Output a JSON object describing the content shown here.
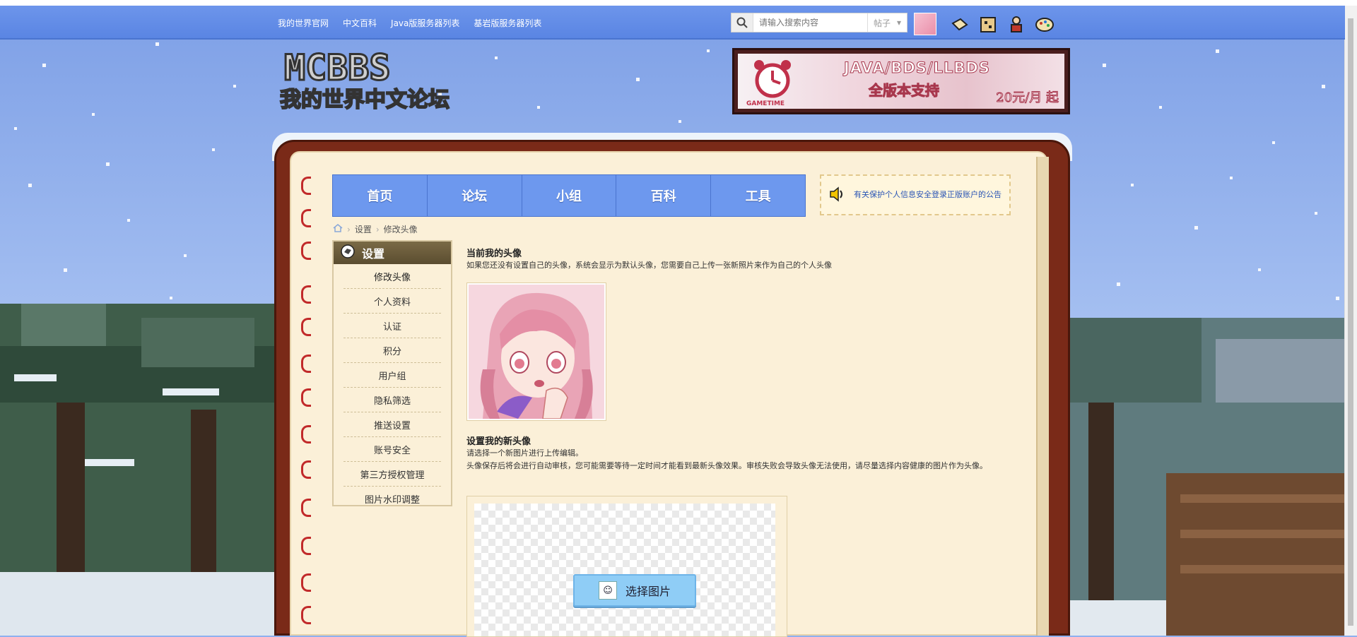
{
  "topbar": {
    "links": [
      "我的世界官网",
      "中文百科",
      "Java版服务器列表",
      "基岩版服务器列表"
    ],
    "search_placeholder": "请输入搜索内容",
    "search_type": "帖子"
  },
  "ad": {
    "title": "JAVA/BDS/LLBDS",
    "subtitle": "全版本支持",
    "price": "20元/月 起",
    "brand": "GAMETIME"
  },
  "main_nav": [
    "首页",
    "论坛",
    "小组",
    "百科",
    "工具"
  ],
  "notice": "有关保护个人信息安全登录正版账户的公告",
  "breadcrumb": [
    "设置",
    "修改头像"
  ],
  "sidebar": {
    "title": "设置",
    "items": [
      "修改头像",
      "个人资料",
      "认证",
      "积分",
      "用户组",
      "隐私筛选",
      "推送设置",
      "账号安全",
      "第三方授权管理",
      "图片水印调整"
    ]
  },
  "content": {
    "current_title": "当前我的头像",
    "current_desc": "如果您还没有设置自己的头像，系统会显示为默认头像，您需要自己上传一张新照片来作为自己的个人头像",
    "new_title": "设置我的新头像",
    "new_desc1": "请选择一个新图片进行上传编辑。",
    "new_desc2": "头像保存后将会进行自动审核，您可能需要等待一定时间才能看到最新头像效果。审核失败会导致头像无法使用，请尽量选择内容健康的图片作为头像。",
    "choose_button": "选择图片"
  },
  "colors": {
    "nav_blue": "#6d98ee",
    "book_brown": "#7a2a18",
    "page_cream": "#fbf0d8",
    "button_blue": "#8fcdf6"
  }
}
